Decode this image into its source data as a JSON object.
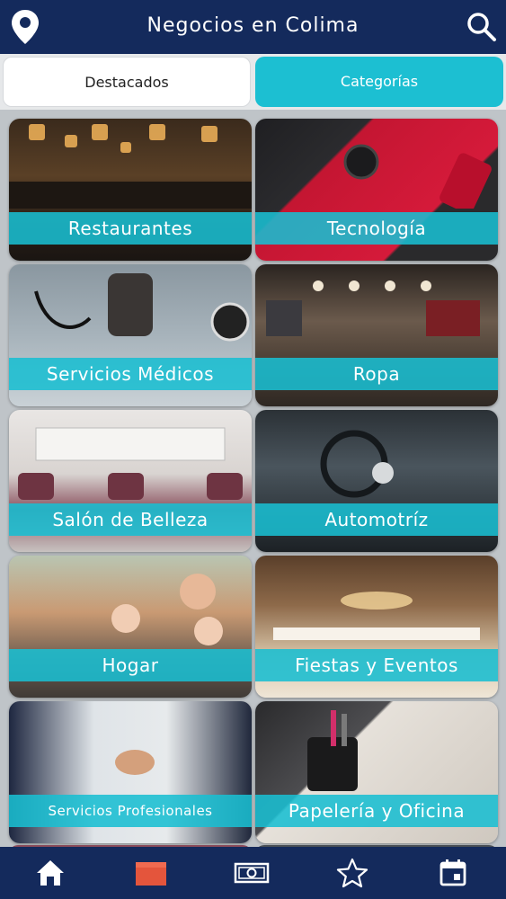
{
  "header": {
    "title": "Negocios en Colima",
    "left_icon": "map-pin-icon",
    "right_icon": "search-icon",
    "background": "#142a5c"
  },
  "tabs": [
    {
      "label": "Destacados",
      "active": false
    },
    {
      "label": "Categorías",
      "active": true
    }
  ],
  "accent_color": "#1cbfd2",
  "categories": [
    {
      "label": "Restaurantes"
    },
    {
      "label": "Tecnología"
    },
    {
      "label": "Servicios Médicos"
    },
    {
      "label": "Ropa"
    },
    {
      "label": "Salón de Belleza"
    },
    {
      "label": "Automotríz"
    },
    {
      "label": "Hogar"
    },
    {
      "label": "Fiestas y Eventos"
    },
    {
      "label": "Servicios Profesionales"
    },
    {
      "label": "Papelería y Oficina"
    }
  ],
  "bottom_nav": [
    {
      "icon": "home-icon"
    },
    {
      "icon": "store-icon",
      "active": true
    },
    {
      "icon": "money-icon"
    },
    {
      "icon": "star-icon"
    },
    {
      "icon": "calendar-icon"
    }
  ]
}
